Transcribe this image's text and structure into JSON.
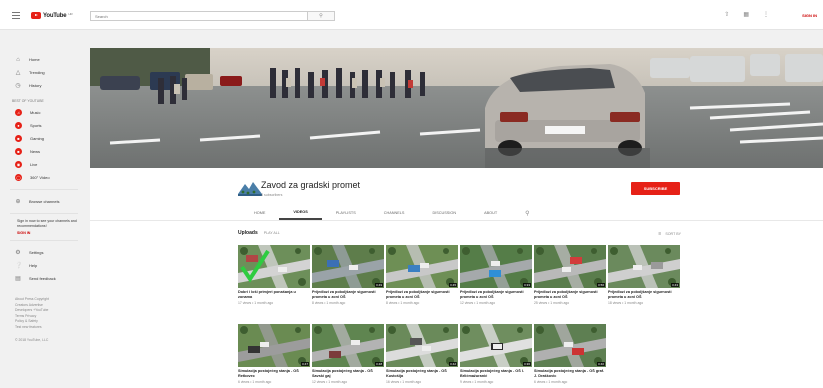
{
  "masthead": {
    "logo_text": "YouTube",
    "logo_sup": "HR",
    "search_placeholder": "Search",
    "sign_in": "SIGN IN"
  },
  "sidebar": {
    "main_items": [
      {
        "label": "Home",
        "icon": "home-icon"
      },
      {
        "label": "Trending",
        "icon": "trending-icon"
      },
      {
        "label": "History",
        "icon": "history-icon"
      }
    ],
    "best_heading": "BEST OF YOUTUBE",
    "best_items": [
      {
        "label": "Music",
        "icon": "music-icon"
      },
      {
        "label": "Sports",
        "icon": "sports-icon"
      },
      {
        "label": "Gaming",
        "icon": "gaming-icon"
      },
      {
        "label": "News",
        "icon": "news-icon"
      },
      {
        "label": "Live",
        "icon": "live-icon"
      },
      {
        "label": "360° Video",
        "icon": "360-video-icon"
      }
    ],
    "browse_channels": "Browse channels",
    "signin_note": "Sign in now to see your channels and recommendations!",
    "signin_link": "SIGN IN",
    "bottom_items": [
      {
        "label": "Settings",
        "icon": "gear-icon"
      },
      {
        "label": "Help",
        "icon": "help-icon"
      },
      {
        "label": "Send feedback",
        "icon": "feedback-icon"
      }
    ],
    "footer_line1": "About  Press  Copyright",
    "footer_line2": "Creators  Advertise",
    "footer_line3": "Developers  +YouTube",
    "footer_line4": "Terms  Privacy",
    "footer_line5": "Policy & Safety",
    "footer_line6": "Test new features",
    "copyright": "© 2018 YouTube, LLC"
  },
  "channel": {
    "name": "Zavod za gradski promet",
    "subscribers": "3 subscribers",
    "subscribe_label": "SUBSCRIBE",
    "tabs": [
      "HOME",
      "VIDEOS",
      "PLAYLISTS",
      "CHANNELS",
      "DISCUSSION",
      "ABOUT"
    ],
    "active_tab": "VIDEOS"
  },
  "uploads": {
    "title": "Uploads",
    "play_all": "PLAY ALL",
    "sort_by": "SORT BY"
  },
  "colors": {
    "brand_red": "#e62117",
    "masthead_bg": "#ffffff",
    "page_bg": "#f1f1f1"
  },
  "videos": [
    {
      "title": "Dobri i loši primjeri ponašanja u zonama",
      "meta": "17 views • 1 month ago",
      "duration": "",
      "watched": true
    },
    {
      "title": "Prijedlozi za poboljšanje sigurnosti prometa u zoni OŠ",
      "meta": "8 views • 1 month ago",
      "duration": "0:49"
    },
    {
      "title": "Prijedlozi za poboljšanje sigurnosti prometa u zoni OŠ",
      "meta": "8 views • 1 month ago",
      "duration": "0:45"
    },
    {
      "title": "Prijedlozi za poboljšanje sigurnosti prometa u zoni OŠ",
      "meta": "12 views • 1 month ago",
      "duration": "0:33"
    },
    {
      "title": "Prijedlozi za poboljšanje sigurnosti prometa u zoni OŠ",
      "meta": "25 views • 1 month ago",
      "duration": "0:56"
    },
    {
      "title": "Prijedlozi za poboljšanje sigurnosti prometa u zoni OŠ",
      "meta": "18 views • 1 month ago",
      "duration": "0:43"
    },
    {
      "title": "Simulacija postojećeg stanja - OŠ Retkovec",
      "meta": "6 views • 1 month ago",
      "duration": "0:47"
    },
    {
      "title": "Simulacija postojećeg stanja - OŠ Savski gaj",
      "meta": "12 views • 1 month ago",
      "duration": "0:48"
    },
    {
      "title": "Simulacija postojećeg stanja - OŠ Kustošija",
      "meta": "16 views • 1 month ago",
      "duration": "0:42"
    },
    {
      "title": "Simulacija postojećeg stanja - OŠ I. Brlićmažuranić",
      "meta": "9 views • 1 month ago",
      "duration": "0:36"
    },
    {
      "title": "Simulacija postojećeg stanja - OŠ graf. J. Draškovic",
      "meta": "6 views • 1 month ago",
      "duration": "0:40"
    }
  ]
}
